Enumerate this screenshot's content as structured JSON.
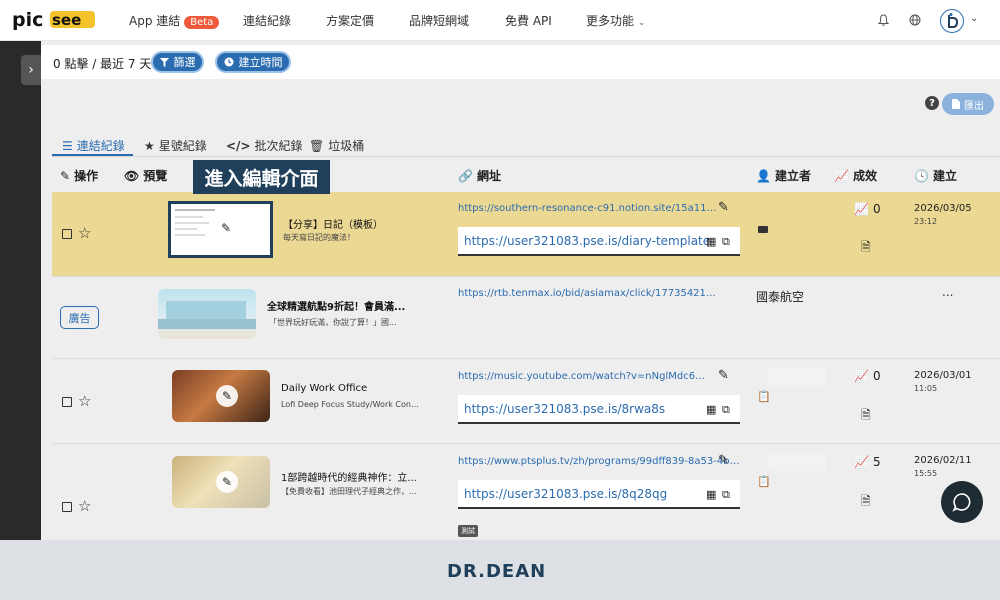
{
  "nav": {
    "logo": "picsee",
    "items": [
      "App 連結",
      "連結紀錄",
      "方案定價",
      "品牌短網域",
      "免費 API",
      "更多功能"
    ],
    "beta": "Beta",
    "bell_icon": "bell-icon",
    "globe_icon": "globe-icon",
    "avatar_icon": "avatar-icon"
  },
  "filter": {
    "summary": "0 點擊 / 最近 7 天",
    "filter_label": "篩選",
    "time_label": "建立時間"
  },
  "toolbar": {
    "export_label": "匯出"
  },
  "tabs": [
    "連結紀錄",
    "星號紀錄",
    "批次紀錄",
    "垃圾桶"
  ],
  "headers": {
    "ops": "操作",
    "preview": "預覽",
    "url": "網址",
    "creator": "建立者",
    "performance": "成效",
    "created": "建立"
  },
  "tooltip": "進入編輯介面",
  "rows": [
    {
      "title": "【分享】日記（模板）",
      "desc": "每天寫日記的魔法！",
      "url": "https://southern-resonance-c91.notion.site/15a1121b9af38",
      "short": "https://user321083.pse.is/diary-template",
      "clicks": "0",
      "date": "2026/03/05",
      "time": "23:12"
    },
    {
      "ad": "廣告",
      "title": "全球精選航點9折起！會員滿...",
      "desc": "「世界玩好玩滿，你說了算！」國...",
      "url": "https://rtb.tenmax.io/bid/asiamax/click/177354219...",
      "creator": "國泰航空",
      "more": "..."
    },
    {
      "title": "Daily Work Office",
      "desc": "Lofi Deep Focus Study/Work Conce...",
      "url": "https://music.youtube.com/watch?v=nNglMdc6wqU",
      "short": "https://user321083.pse.is/8rwa8s",
      "clicks": "0",
      "date": "2026/03/01",
      "time": "11:05"
    },
    {
      "title": "1部跨越時代的經典神作：立...",
      "desc": "【免費收看】池田理代子經典之作，...",
      "url": "https://www.ptsplus.tv/zh/programs/99dff839-8a53-4b6e-a",
      "short": "https://user321083.pse.is/8q28qg",
      "clicks": "5",
      "date": "2026/02/11",
      "time": "15:55",
      "tag": "測試"
    }
  ],
  "footer": {
    "brand": "DR.DEAN"
  }
}
